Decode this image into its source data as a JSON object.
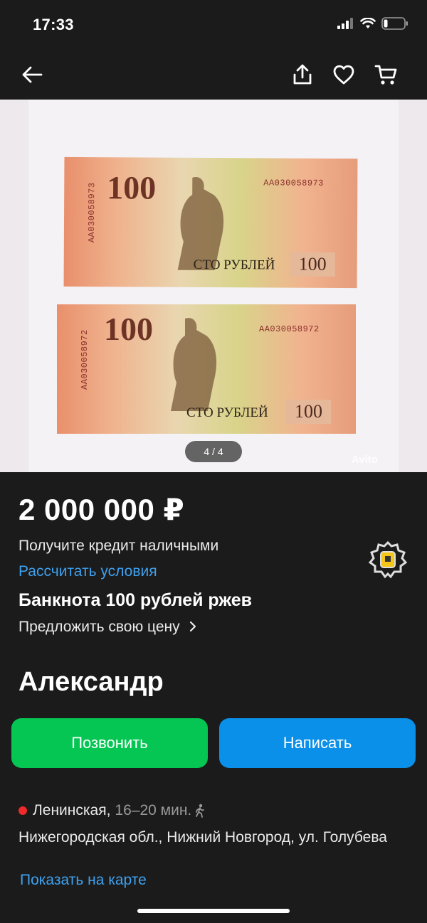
{
  "status": {
    "time": "17:33"
  },
  "nav": {
    "back_icon": "arrow-left-icon",
    "share_icon": "share-icon",
    "favorite_icon": "heart-icon",
    "cart_icon": "cart-icon"
  },
  "gallery": {
    "counter": "4 / 4",
    "watermark": "Avito",
    "notes": [
      {
        "denomination": "100",
        "serial": "АА030058973",
        "words": "СТО РУБЛЕЙ"
      },
      {
        "denomination": "100",
        "serial": "АА030058972",
        "words": "СТО РУБЛЕЙ"
      }
    ]
  },
  "listing": {
    "price": "2 000 000 ₽",
    "credit_text": "Получите кредит наличными",
    "credit_link": "Рассчитать условия",
    "title": "Банкнота 100 рублей ржев",
    "offer_text": "Предложить свою цену"
  },
  "seller": {
    "name": "Александр",
    "call_label": "Позвонить",
    "write_label": "Написать"
  },
  "location": {
    "metro": "Ленинская,",
    "metro_time": "16–20 мин.",
    "metro_color": "#ef2a2a",
    "address": "Нижегородская обл., Нижний Новгород, ул. Голубева",
    "map_link": "Показать на карте"
  },
  "colors": {
    "call_button": "#05c653",
    "write_button": "#0a90e8",
    "link": "#3ea1f0",
    "background": "#1b1b1b"
  }
}
